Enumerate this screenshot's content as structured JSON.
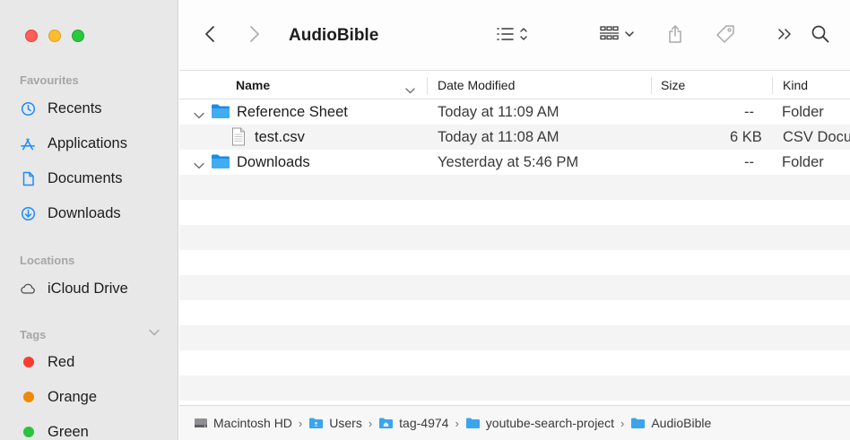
{
  "window": {
    "title": "AudioBible"
  },
  "sidebar": {
    "favourites_label": "Favourites",
    "favourites": [
      {
        "label": "Recents",
        "icon": "clock-icon"
      },
      {
        "label": "Applications",
        "icon": "applications-icon"
      },
      {
        "label": "Documents",
        "icon": "document-icon"
      },
      {
        "label": "Downloads",
        "icon": "download-icon"
      }
    ],
    "locations_label": "Locations",
    "locations": [
      {
        "label": "iCloud Drive",
        "icon": "cloud-icon"
      }
    ],
    "tags_label": "Tags",
    "tags": [
      {
        "label": "Red",
        "color": "#fe3b30"
      },
      {
        "label": "Orange",
        "color": "#f08a00"
      },
      {
        "label": "Green",
        "color": "#2ac23f"
      }
    ]
  },
  "toolbar": {
    "back_icon": "chevron-left-icon",
    "forward_icon": "chevron-right-icon",
    "list_view_icon": "list-view-icon",
    "group_icon": "group-grid-icon",
    "share_icon": "share-icon",
    "tag_icon": "tag-icon",
    "more_icon": "double-chevron-icon",
    "search_icon": "search-icon"
  },
  "columns": {
    "name": "Name",
    "date": "Date Modified",
    "size": "Size",
    "kind": "Kind"
  },
  "files": [
    {
      "name": "Reference Sheet",
      "date": "Today at 11:09 AM",
      "size": "--",
      "kind": "Folder",
      "type": "folder",
      "expanded": true,
      "indent": 0
    },
    {
      "name": "test.csv",
      "date": "Today at 11:08 AM",
      "size": "6 KB",
      "kind": "CSV Document",
      "type": "file",
      "indent": 1
    },
    {
      "name": "Downloads",
      "date": "Yesterday at 5:46 PM",
      "size": "--",
      "kind": "Folder",
      "type": "folder",
      "expanded": true,
      "indent": 0
    }
  ],
  "pathbar": [
    {
      "label": "Macintosh HD",
      "icon": "hard-drive-icon"
    },
    {
      "label": "Users",
      "icon": "users-folder-icon"
    },
    {
      "label": "tag-4974",
      "icon": "home-folder-icon"
    },
    {
      "label": "youtube-search-project",
      "icon": "folder-icon"
    },
    {
      "label": "AudioBible",
      "icon": "folder-icon"
    }
  ],
  "colors": {
    "accent": "#1a8cff",
    "folder": "#38a8f0",
    "sidebar_bg": "#e9e8e8"
  }
}
